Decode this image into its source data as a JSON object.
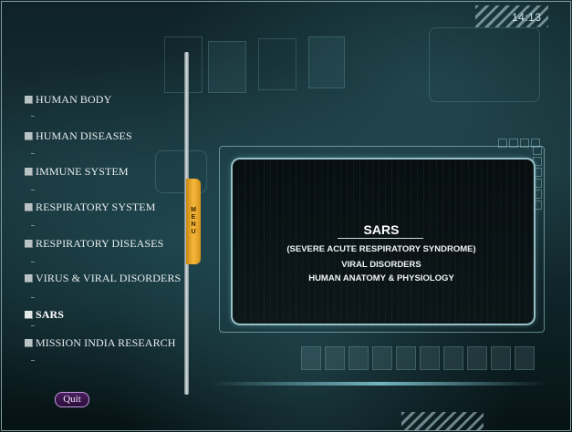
{
  "clock": "14:13",
  "menu": {
    "tab_letters": [
      "M",
      "E",
      "N",
      "U"
    ],
    "items": [
      {
        "label": "HUMAN BODY",
        "active": false
      },
      {
        "label": "HUMAN DISEASES",
        "active": false
      },
      {
        "label": "IMMUNE SYSTEM",
        "active": false
      },
      {
        "label": "RESPIRATORY SYSTEM",
        "active": false
      },
      {
        "label": "RESPIRATORY DISEASES",
        "active": false
      },
      {
        "label": "VIRUS & VIRAL DISORDERS",
        "active": false
      },
      {
        "label": "SARS",
        "active": true
      },
      {
        "label": "MISSION INDIA RESEARCH",
        "active": false
      }
    ]
  },
  "panel": {
    "title": "SARS",
    "lines": [
      "(SEVERE ACUTE RESPIRATORY SYNDROME)",
      "VIRAL DISORDERS",
      "HUMAN ANATOMY & PHYSIOLOGY"
    ]
  },
  "quit_label": "Quit",
  "colors": {
    "menu_tab": "#f4b73b",
    "panel_border": "#afe1e6",
    "quit_border": "#c39be0"
  }
}
